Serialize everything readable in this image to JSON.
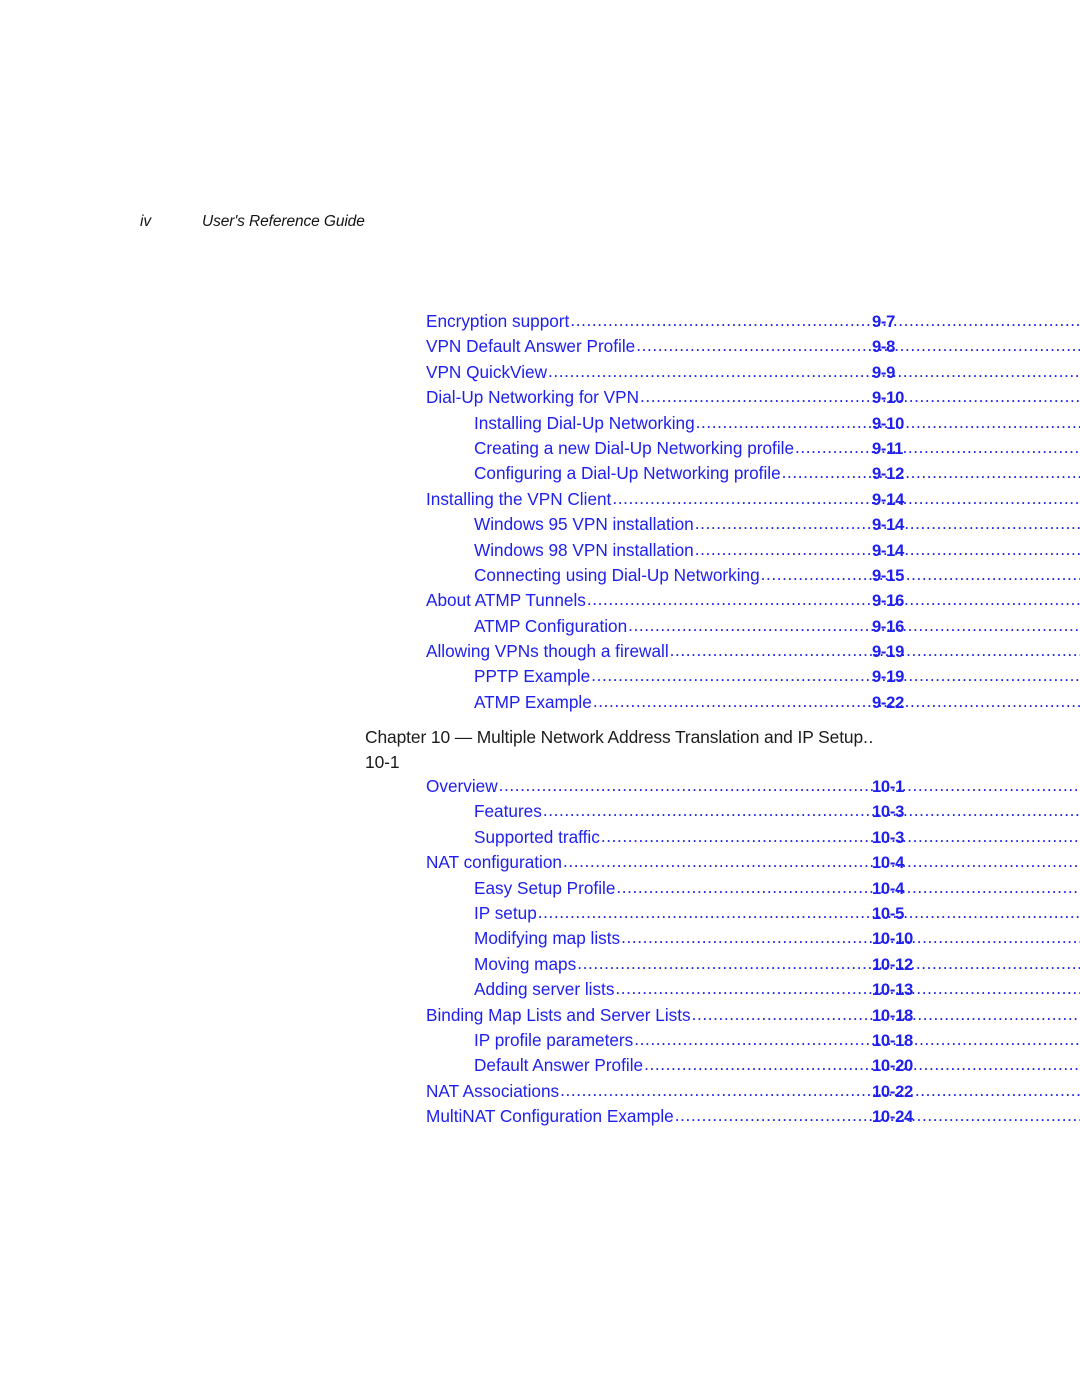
{
  "page": {
    "background": "#ffffff",
    "entry_color": "#2020ee",
    "heading_color": "#1b1b1b"
  },
  "running_head": {
    "folio": "iv",
    "title": "User's Reference Guide"
  },
  "toc": {
    "entries": [
      {
        "level": 1,
        "label": "Encryption support",
        "page": "9-7"
      },
      {
        "level": 1,
        "label": "VPN Default Answer Profile",
        "page": "9-8"
      },
      {
        "level": 1,
        "label": "VPN QuickView",
        "page": "9-9"
      },
      {
        "level": 1,
        "label": "Dial-Up Networking for VPN",
        "page": "9-10"
      },
      {
        "level": 2,
        "label": "Installing Dial-Up Networking",
        "page": "9-10"
      },
      {
        "level": 2,
        "label": "Creating a new Dial-Up Networking profile",
        "page": "9-11"
      },
      {
        "level": 2,
        "label": "Configuring a Dial-Up Networking profile",
        "page": "9-12"
      },
      {
        "level": 1,
        "label": "Installing the VPN Client",
        "page": "9-14"
      },
      {
        "level": 2,
        "label": "Windows 95 VPN installation",
        "page": "9-14"
      },
      {
        "level": 2,
        "label": "Windows 98 VPN installation",
        "page": "9-14"
      },
      {
        "level": 2,
        "label": "Connecting using Dial-Up Networking",
        "page": "9-15"
      },
      {
        "level": 1,
        "label": "About ATMP Tunnels",
        "page": "9-16"
      },
      {
        "level": 2,
        "label": "ATMP Configuration",
        "page": "9-16"
      },
      {
        "level": 1,
        "label": "Allowing VPNs though a firewall",
        "page": "9-19"
      },
      {
        "level": 2,
        "label": "PPTP Example",
        "page": "9-19"
      },
      {
        "level": 2,
        "label": "ATMP Example",
        "page": "9-22"
      }
    ]
  },
  "chapter_heading": {
    "text": "Chapter 10 — Multiple Network Address Translation and IP Setup",
    "dots": "..",
    "page": "10-1"
  },
  "toc2": {
    "entries": [
      {
        "level": 1,
        "label": "Overview",
        "page": "10-1"
      },
      {
        "level": 2,
        "label": "Features",
        "page": "10-3"
      },
      {
        "level": 2,
        "label": "Supported traffic",
        "page": "10-3"
      },
      {
        "level": 1,
        "label": "NAT configuration",
        "page": "10-4"
      },
      {
        "level": 2,
        "label": "Easy Setup Profile",
        "page": "10-4"
      },
      {
        "level": 2,
        "label": "IP setup",
        "page": "10-5"
      },
      {
        "level": 2,
        "label": "Modifying map lists",
        "page": "10-10"
      },
      {
        "level": 2,
        "label": "Moving maps",
        "page": "10-12"
      },
      {
        "level": 2,
        "label": "Adding server lists",
        "page": "10-13"
      },
      {
        "level": 1,
        "label": "Binding Map Lists and Server Lists",
        "page": "10-18"
      },
      {
        "level": 2,
        "label": "IP profile parameters",
        "page": "10-18"
      },
      {
        "level": 2,
        "label": "Default Answer Profile",
        "page": "10-20"
      },
      {
        "level": 1,
        "label": "NAT Associations",
        "page": "10-22"
      },
      {
        "level": 1,
        "label": "MultiNAT Configuration Example",
        "page": "10-24"
      }
    ]
  }
}
